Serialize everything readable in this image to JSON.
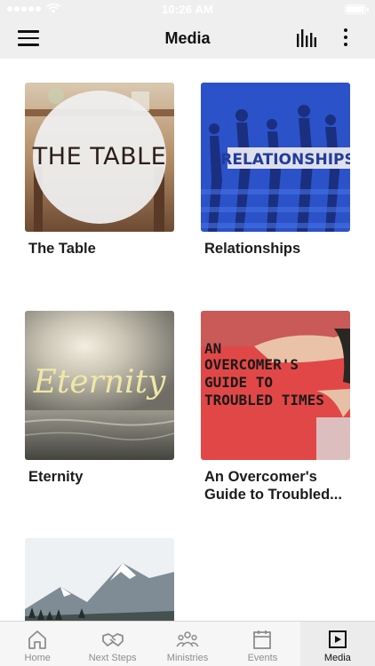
{
  "status_bar": {
    "time": "10:26 AM"
  },
  "header": {
    "title": "Media"
  },
  "media_items": [
    {
      "title": "The Table",
      "thumb_text": "THE TABLE"
    },
    {
      "title": "Relationships",
      "thumb_text": "RELATIONSHIPS"
    },
    {
      "title": "Eternity",
      "thumb_text": "Eternity"
    },
    {
      "title": "An Overcomer's Guide to Troubled...",
      "thumb_text": [
        "AN",
        "OVERCOMER'S",
        "GUIDE TO",
        "TROUBLED TIMES"
      ]
    },
    {
      "title": ""
    }
  ],
  "tabs": [
    {
      "label": "Home",
      "icon": "home-icon"
    },
    {
      "label": "Next Steps",
      "icon": "handshake-icon"
    },
    {
      "label": "Ministries",
      "icon": "people-icon"
    },
    {
      "label": "Events",
      "icon": "calendar-icon"
    },
    {
      "label": "Media",
      "icon": "play-icon",
      "active": true
    }
  ],
  "colors": {
    "accent": "#111111",
    "tab_inactive": "#8e8e8e",
    "bar_bg": "#efefef"
  }
}
